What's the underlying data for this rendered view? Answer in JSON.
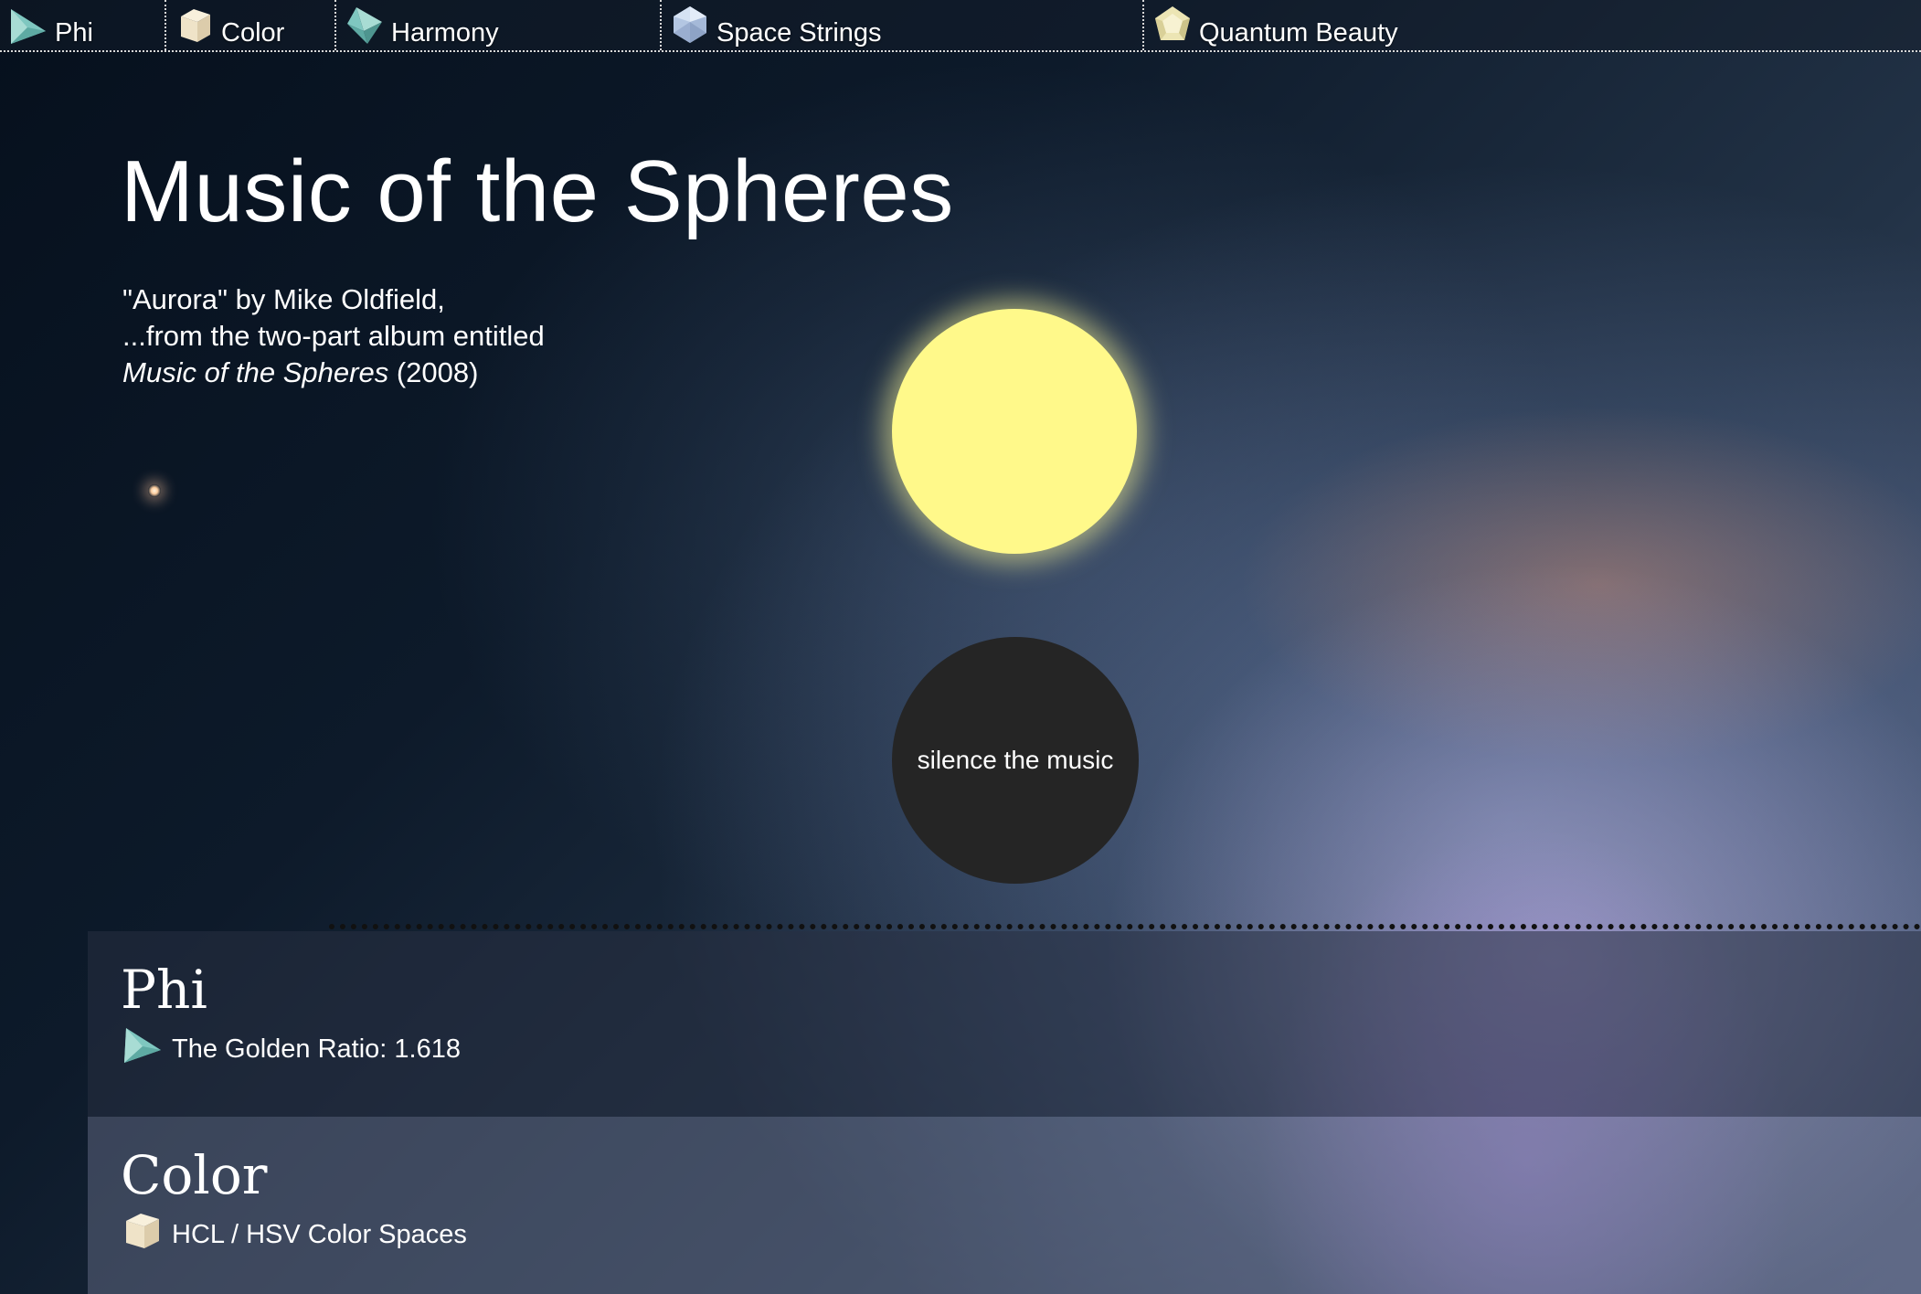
{
  "nav": {
    "items": [
      {
        "label": "Phi",
        "icon": "triangle-icon"
      },
      {
        "label": "Color",
        "icon": "cube-icon"
      },
      {
        "label": "Harmony",
        "icon": "octahedron-icon"
      },
      {
        "label": "Space Strings",
        "icon": "icosahedron-icon"
      },
      {
        "label": "Quantum Beauty",
        "icon": "dodecahedron-icon"
      }
    ]
  },
  "header": {
    "title": "Music of the Spheres",
    "line1": "\"Aurora\" by Mike Oldfield,",
    "line2": "...from the two-part album entitled",
    "album": "Music of the Spheres",
    "year": "(2008)"
  },
  "player": {
    "silence_label": "silence the music"
  },
  "sections": [
    {
      "title": "Phi",
      "item": "The Golden Ratio: 1.618",
      "icon": "triangle-icon"
    },
    {
      "title": "Color",
      "item": "HCL / HSV Color Spaces",
      "icon": "cube-icon"
    }
  ],
  "colors": {
    "sun": "#fff98a",
    "silence_button": "#252525",
    "teal_icon": "#7fc7c0",
    "cube_icon": "#efe3c8"
  }
}
